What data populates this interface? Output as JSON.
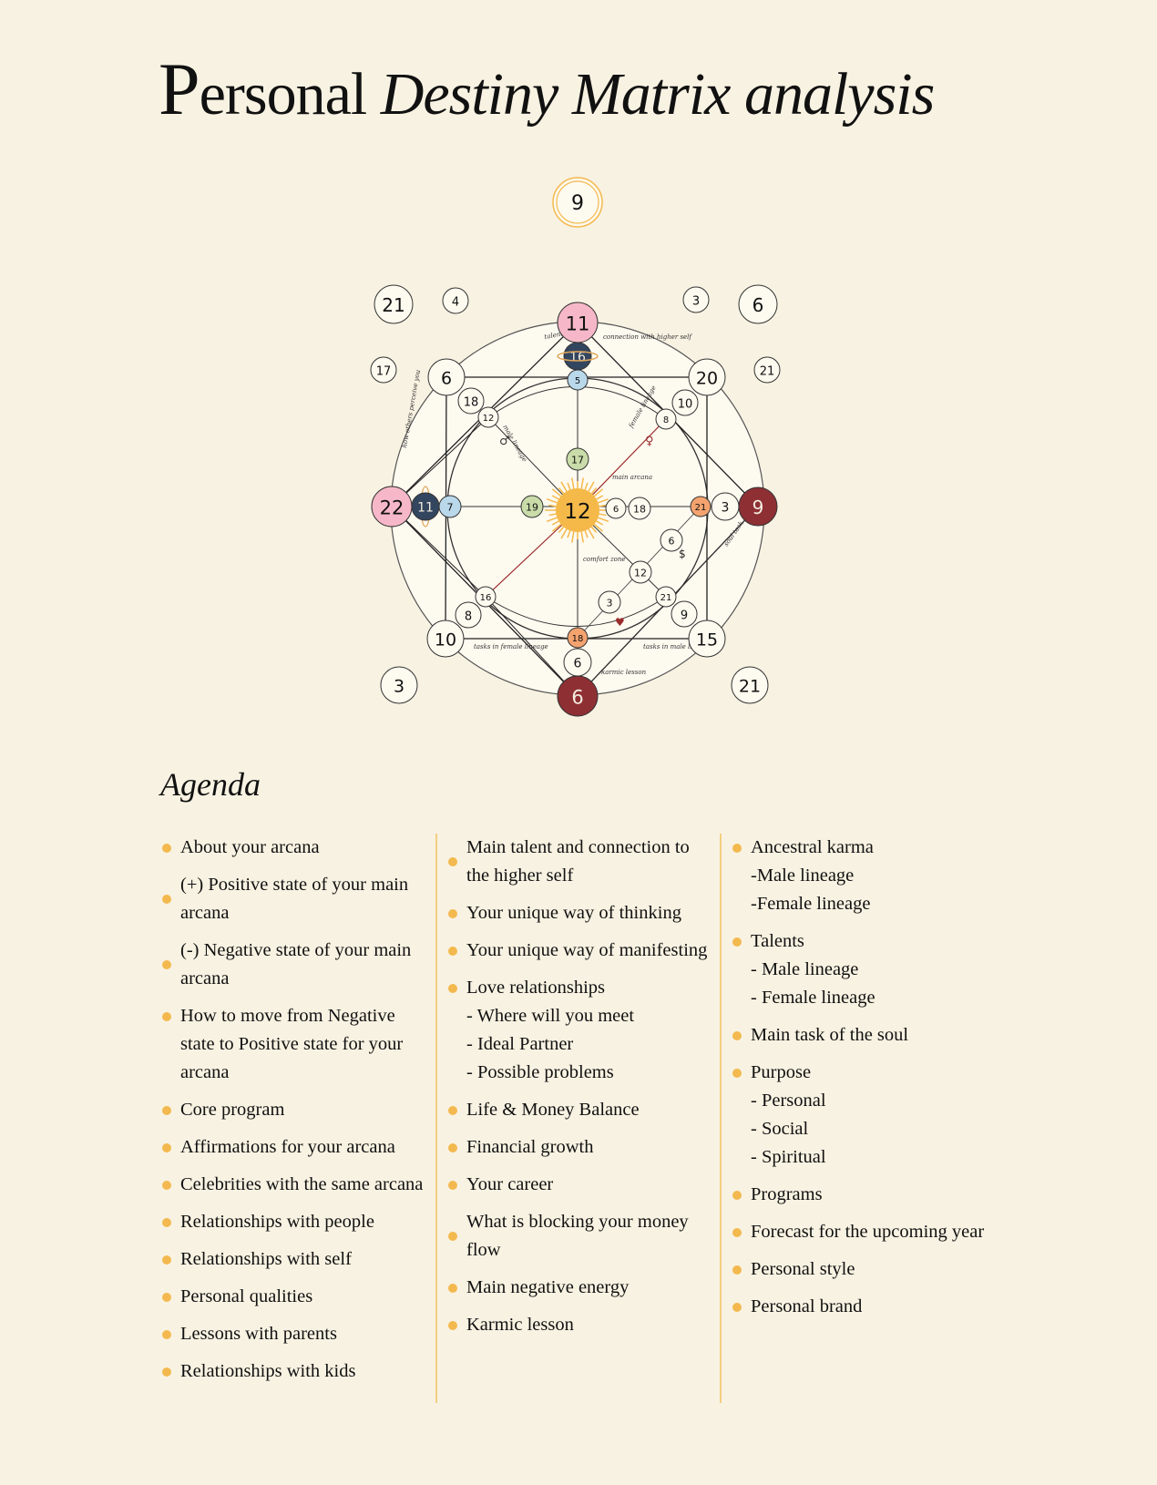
{
  "header": {
    "title_cap": "P",
    "title_rest": "ersonal",
    "title_italic": "Destiny Matrix analysis"
  },
  "colors": {
    "background": "#f8f2e2",
    "accent_gold": "#f3b94e",
    "pink": "#f6b8c8",
    "navy": "#33465f",
    "light_blue": "#b9d8ea",
    "sage": "#c9dca9",
    "peach": "#f4a36f",
    "maroon": "#8e2f34",
    "sun": "#f5b94a",
    "ivory": "#fdfbf0"
  },
  "matrix": {
    "top_number": "9",
    "nodes": [
      {
        "id": "top-outer",
        "value": "11",
        "type": "pink"
      },
      {
        "id": "top-2",
        "value": "16",
        "type": "navy"
      },
      {
        "id": "top-3",
        "value": "5",
        "type": "blue"
      },
      {
        "id": "top-4",
        "value": "17",
        "type": "sage"
      },
      {
        "id": "center",
        "value": "12",
        "type": "sun"
      },
      {
        "id": "left-outer",
        "value": "22",
        "type": "pink"
      },
      {
        "id": "left-2",
        "value": "11",
        "type": "navy"
      },
      {
        "id": "left-3",
        "value": "7",
        "type": "blue"
      },
      {
        "id": "left-4",
        "value": "19",
        "type": "sage"
      },
      {
        "id": "right-outer",
        "value": "9",
        "type": "maroon"
      },
      {
        "id": "right-2",
        "value": "3",
        "type": "plain"
      },
      {
        "id": "right-3",
        "value": "21",
        "type": "peach"
      },
      {
        "id": "right-4",
        "value": "18",
        "type": "plain"
      },
      {
        "id": "right-5",
        "value": "6",
        "type": "plain"
      },
      {
        "id": "bottom-outer",
        "value": "6",
        "type": "maroon"
      },
      {
        "id": "bottom-2",
        "value": "6",
        "type": "plain"
      },
      {
        "id": "bottom-3",
        "value": "18",
        "type": "peach"
      },
      {
        "id": "tl-outer",
        "value": "6",
        "type": "plain"
      },
      {
        "id": "tl-2",
        "value": "18",
        "type": "plain"
      },
      {
        "id": "tl-3",
        "value": "12",
        "type": "plain"
      },
      {
        "id": "tr-outer",
        "value": "20",
        "type": "plain"
      },
      {
        "id": "tr-2",
        "value": "10",
        "type": "plain"
      },
      {
        "id": "tr-3",
        "value": "8",
        "type": "plain"
      },
      {
        "id": "bl-outer",
        "value": "10",
        "type": "plain"
      },
      {
        "id": "bl-2",
        "value": "8",
        "type": "plain"
      },
      {
        "id": "bl-3",
        "value": "16",
        "type": "plain"
      },
      {
        "id": "br-outer",
        "value": "15",
        "type": "plain"
      },
      {
        "id": "br-2",
        "value": "9",
        "type": "plain"
      },
      {
        "id": "br-3",
        "value": "21",
        "type": "plain"
      },
      {
        "id": "money",
        "value": "6",
        "type": "plain"
      },
      {
        "id": "mid",
        "value": "12",
        "type": "plain"
      },
      {
        "id": "love",
        "value": "3",
        "type": "plain"
      },
      {
        "id": "corner-tl",
        "value": "21",
        "type": "plain"
      },
      {
        "id": "corner-tl-small",
        "value": "4",
        "type": "plain"
      },
      {
        "id": "corner-tl-side",
        "value": "17",
        "type": "plain"
      },
      {
        "id": "corner-tr-small",
        "value": "3",
        "type": "plain"
      },
      {
        "id": "corner-tr",
        "value": "6",
        "type": "plain"
      },
      {
        "id": "corner-tr-side",
        "value": "21",
        "type": "plain"
      },
      {
        "id": "corner-bl",
        "value": "3",
        "type": "plain"
      },
      {
        "id": "corner-br",
        "value": "21",
        "type": "plain"
      }
    ],
    "annotations": {
      "talents": "talents",
      "higher_self": "connection with higher self",
      "male_lineage": "male lineage",
      "female_lineage": "female lineage",
      "main_arcana": "main arcana",
      "how_others": "how others perceive you",
      "comfort_zone": "comfort zone",
      "soul_task": "soul task",
      "tasks_female": "tasks in female lineage",
      "tasks_male": "tasks in male lineage",
      "karmic_lesson": "karmic lesson",
      "male_symbol": "♂",
      "female_symbol": "♀",
      "money_symbol": "$",
      "heart_symbol": "♥"
    }
  },
  "agenda": {
    "title": "Agenda",
    "columns": [
      [
        {
          "lines": [
            "About your arcana"
          ]
        },
        {
          "lines": [
            "(+) Positive state of your main",
            "arcana"
          ]
        },
        {
          "lines": [
            "(-) Negative state of your main",
            "arcana"
          ]
        },
        {
          "lines": [
            "How to move from Negative",
            "state to Positive state for your",
            "arcana"
          ]
        },
        {
          "lines": [
            "Core program"
          ]
        },
        {
          "lines": [
            "Affirmations for your arcana"
          ]
        },
        {
          "lines": [
            "Celebrities with the same arcana"
          ]
        },
        {
          "lines": [
            "Relationships with people"
          ]
        },
        {
          "lines": [
            "Relationships with self"
          ]
        },
        {
          "lines": [
            "Personal qualities"
          ]
        },
        {
          "lines": [
            "Lessons with parents"
          ]
        },
        {
          "lines": [
            "Relationships with kids"
          ]
        }
      ],
      [
        {
          "lines": [
            "Main talent and connection to",
            "the higher self"
          ]
        },
        {
          "lines": [
            "Your unique way of thinking"
          ]
        },
        {
          "lines": [
            "Your unique way of manifesting"
          ]
        },
        {
          "lines": [
            "Love relationships",
            "- Where will you meet",
            "- Ideal Partner",
            "- Possible problems"
          ]
        },
        {
          "lines": [
            "Life & Money Balance"
          ]
        },
        {
          "lines": [
            "Financial growth"
          ]
        },
        {
          "lines": [
            "Your career"
          ]
        },
        {
          "lines": [
            "What is blocking your money",
            "flow"
          ]
        },
        {
          "lines": [
            "Main negative energy"
          ]
        },
        {
          "lines": [
            "Karmic lesson"
          ]
        }
      ],
      [
        {
          "lines": [
            "Ancestral karma",
            "-Male lineage",
            "-Female lineage"
          ]
        },
        {
          "lines": [
            "Talents",
            "- Male lineage",
            "- Female lineage"
          ]
        },
        {
          "lines": [
            "Main task of the soul"
          ]
        },
        {
          "lines": [
            "Purpose",
            "- Personal",
            "- Social",
            "- Spiritual"
          ]
        },
        {
          "lines": [
            "Programs"
          ]
        },
        {
          "lines": [
            "Forecast for the upcoming year"
          ]
        },
        {
          "lines": [
            "Personal style"
          ]
        },
        {
          "lines": [
            "Personal brand"
          ]
        }
      ]
    ]
  }
}
